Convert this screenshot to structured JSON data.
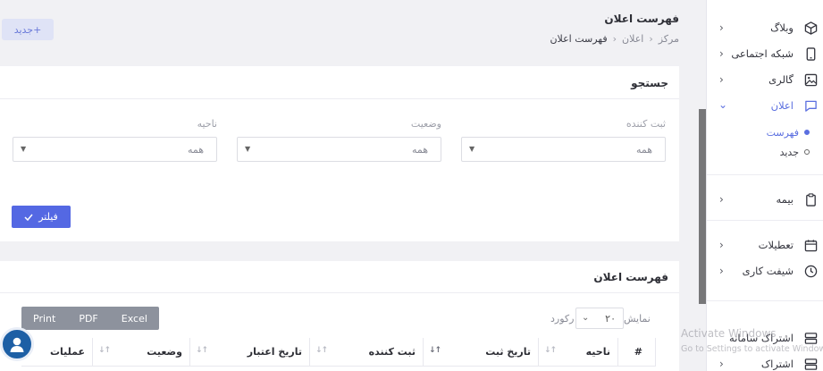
{
  "header": {
    "title": "فهرست اعلان",
    "breadcrumb": [
      "مرکز",
      "اعلان",
      "فهرست اعلان"
    ],
    "new_button": "+جدید"
  },
  "sidebar": {
    "items": [
      {
        "label": "وبلاگ",
        "icon": "cube-icon"
      },
      {
        "label": "شبکه اجتماعی",
        "icon": "phone-icon"
      },
      {
        "label": "گالری",
        "icon": "image-icon"
      },
      {
        "label": "اعلان",
        "icon": "chat-icon",
        "active": true
      },
      {
        "label": "بیمه",
        "icon": "clipboard-icon"
      },
      {
        "label": "تعطیلات",
        "icon": "calendar-icon"
      },
      {
        "label": "شیفت کاری",
        "icon": "clock-icon"
      },
      {
        "label": "اشتراک سامانه",
        "icon": "server-icon"
      },
      {
        "label": "اشتراک",
        "icon": "server-icon"
      }
    ],
    "subitems": [
      {
        "label": "فهرست",
        "active": true
      },
      {
        "label": "جدید",
        "active": false
      }
    ]
  },
  "search": {
    "title": "جستجو",
    "fields": [
      {
        "label": "ثبت کننده",
        "value": "همه"
      },
      {
        "label": "وضعیت",
        "value": "همه"
      },
      {
        "label": "ناحیه",
        "value": "همه"
      }
    ],
    "filter_button": "فیلتر"
  },
  "list": {
    "title": "فهرست اعلان",
    "export": [
      "Print",
      "PDF",
      "Excel"
    ],
    "show_label": "نمایش",
    "page_size": "۲۰",
    "records_label": "رکورد",
    "columns": [
      "#",
      "ناحیه",
      "تاریخ ثبت",
      "ثبت کننده",
      "تاریخ اعتبار",
      "وضعیت",
      "عملیات"
    ]
  },
  "watermark": {
    "line1": "Activate Windows",
    "line2": "Go to Settings to activate Windows."
  },
  "colors": {
    "accent": "#5468e3",
    "export_bg": "#8d929d",
    "new_button_bg": "#dfe3f6"
  }
}
